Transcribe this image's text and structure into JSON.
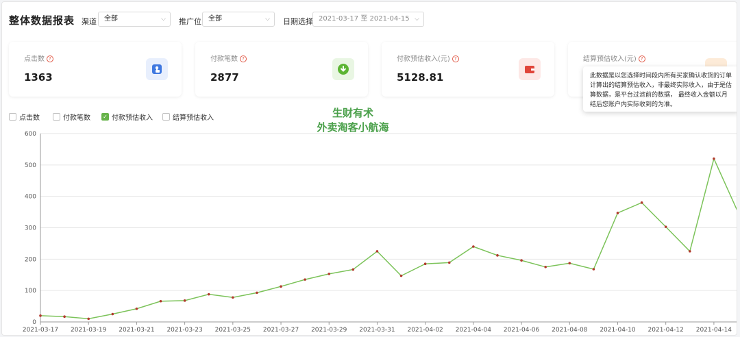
{
  "header": {
    "title": "整体数据报表",
    "channel_label": "渠道",
    "channel_value": "全部",
    "promo_label": "推广位",
    "promo_value": "全部",
    "date_label": "日期选择",
    "date_start": "2021-03-17",
    "date_sep": "至",
    "date_end": "2021-04-15"
  },
  "cards": [
    {
      "label": "点击数",
      "value": "1363",
      "icon": "hand-pointer-icon"
    },
    {
      "label": "付款笔数",
      "value": "2877",
      "icon": "download-badge-icon"
    },
    {
      "label": "付款预估收入(元)",
      "value": "5128.81",
      "icon": "wallet-icon"
    },
    {
      "label": "结算预估收入(元)",
      "value": "",
      "icon": "gift-icon"
    }
  ],
  "legend": [
    {
      "label": "点击数",
      "checked": false
    },
    {
      "label": "付款笔数",
      "checked": false
    },
    {
      "label": "付款预估收入",
      "checked": true
    },
    {
      "label": "结算预估收入",
      "checked": false
    }
  ],
  "tooltip": "此数据是以您选择时间段内所有买家确认收货的订单计算出的结算预估收入，非最终实际收入，由于是估算数据，是平台过滤前的数据， 最终收入金额以月结后您账户内实际收到的为准。",
  "watermark": {
    "line1": "生财有术",
    "line2": "外卖淘客小航海"
  },
  "colors": {
    "line": "#7cc35a",
    "point": "#b33a2e",
    "accent": "#67b34a"
  },
  "chart_data": {
    "type": "line",
    "series": [
      {
        "name": "付款预估收入",
        "x": [
          "2021-03-17",
          "2021-03-18",
          "2021-03-19",
          "2021-03-20",
          "2021-03-21",
          "2021-03-22",
          "2021-03-23",
          "2021-03-24",
          "2021-03-25",
          "2021-03-26",
          "2021-03-27",
          "2021-03-28",
          "2021-03-29",
          "2021-03-30",
          "2021-03-31",
          "2021-04-01",
          "2021-04-02",
          "2021-04-03",
          "2021-04-04",
          "2021-04-05",
          "2021-04-06",
          "2021-04-07",
          "2021-04-08",
          "2021-04-09",
          "2021-04-10",
          "2021-04-11",
          "2021-04-12",
          "2021-04-13",
          "2021-04-14",
          "2021-04-15"
        ],
        "values": [
          20,
          17,
          10,
          25,
          42,
          66,
          68,
          88,
          78,
          93,
          113,
          135,
          153,
          167,
          225,
          147,
          185,
          189,
          240,
          212,
          196,
          175,
          187,
          168,
          347,
          380,
          303,
          225,
          520,
          350
        ]
      }
    ],
    "xticks": [
      "2021-03-17",
      "2021-03-19",
      "2021-03-21",
      "2021-03-23",
      "2021-03-25",
      "2021-03-27",
      "2021-03-29",
      "2021-03-31",
      "2021-04-02",
      "2021-04-04",
      "2021-04-06",
      "2021-04-08",
      "2021-04-10",
      "2021-04-12",
      "2021-04-14"
    ],
    "yticks": [
      0,
      100,
      200,
      300,
      400,
      500,
      600
    ],
    "ylim": [
      0,
      600
    ],
    "grid": true
  }
}
